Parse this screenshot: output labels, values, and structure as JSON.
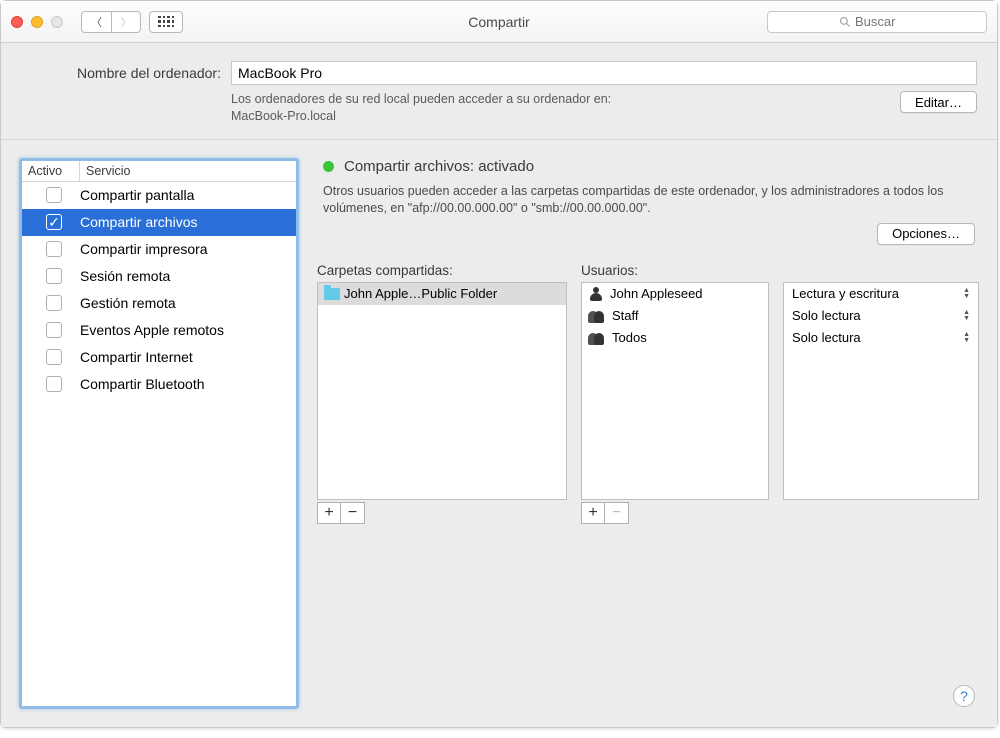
{
  "window": {
    "title": "Compartir",
    "search_placeholder": "Buscar"
  },
  "computer_name": {
    "label": "Nombre del ordenador:",
    "value": "MacBook Pro",
    "subtext_line1": "Los ordenadores de su red local pueden acceder a su ordenador en:",
    "subtext_line2": "MacBook-Pro.local",
    "edit_btn": "Editar…"
  },
  "services": {
    "col_active": "Activo",
    "col_service": "Servicio",
    "items": [
      {
        "label": "Compartir pantalla",
        "checked": false,
        "selected": false
      },
      {
        "label": "Compartir archivos",
        "checked": true,
        "selected": true
      },
      {
        "label": "Compartir impresora",
        "checked": false,
        "selected": false
      },
      {
        "label": "Sesión remota",
        "checked": false,
        "selected": false
      },
      {
        "label": "Gestión remota",
        "checked": false,
        "selected": false
      },
      {
        "label": "Eventos Apple remotos",
        "checked": false,
        "selected": false
      },
      {
        "label": "Compartir Internet",
        "checked": false,
        "selected": false
      },
      {
        "label": "Compartir Bluetooth",
        "checked": false,
        "selected": false
      }
    ]
  },
  "status": {
    "title": "Compartir archivos: activado",
    "dot_color": "#38c637",
    "description": "Otros usuarios pueden acceder a las carpetas compartidas de este ordenador, y los administradores a todos los volúmenes, en \"afp://00.00.000.00\" o \"smb://00.00.000.00\".",
    "options_btn": "Opciones…"
  },
  "folders": {
    "label": "Carpetas compartidas:",
    "items": [
      {
        "name": "John Apple…Public Folder"
      }
    ]
  },
  "users": {
    "label": "Usuarios:",
    "items": [
      {
        "name": "John Appleseed",
        "icon": "user"
      },
      {
        "name": "Staff",
        "icon": "group"
      },
      {
        "name": "Todos",
        "icon": "group"
      }
    ]
  },
  "permissions": {
    "items": [
      {
        "label": "Lectura y escritura"
      },
      {
        "label": "Solo lectura"
      },
      {
        "label": "Solo lectura"
      }
    ]
  },
  "buttons": {
    "add": "+",
    "remove": "−"
  }
}
